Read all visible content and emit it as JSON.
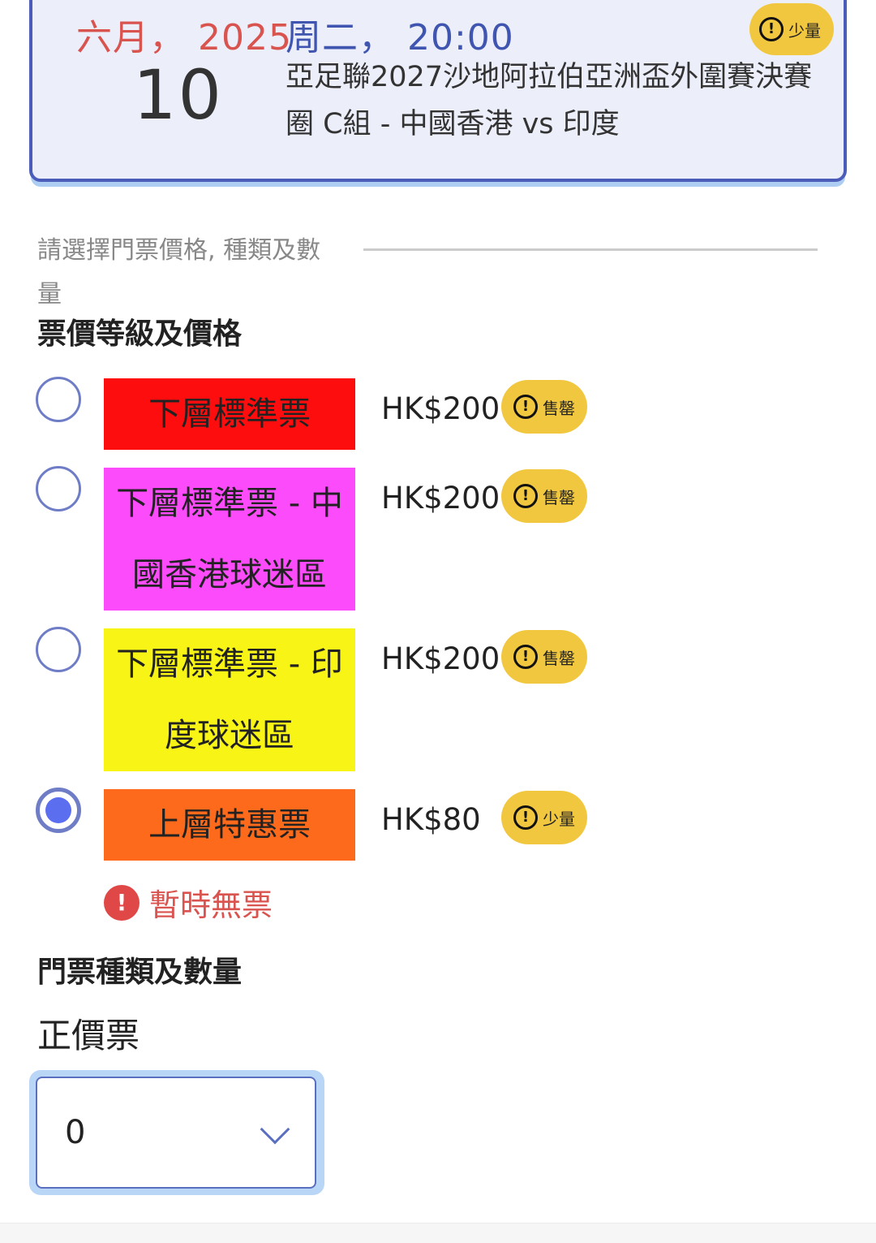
{
  "event": {
    "month_year": "六月， 2025",
    "weekday_time": "周二， 20:00",
    "day": "10",
    "title": "亞足聯2027沙地阿拉伯亞洲盃外圍賽決賽圈 C組 - 中國香港 vs 印度",
    "availability_badge": "少量"
  },
  "selection": {
    "prompt": "請選擇門票價格, 種類及數量",
    "price_heading": "票價等級及價格",
    "tiers": [
      {
        "label": "下層標準票",
        "price": "HK$200",
        "status": "售罄",
        "color": "#fd0d0d",
        "selected": false
      },
      {
        "label": "下層標準票 - 中國香港球迷區",
        "price": "HK$200",
        "status": "售罄",
        "color": "#fb4bfb",
        "selected": false
      },
      {
        "label": "下層標準票 - 印度球迷區",
        "price": "HK$200",
        "status": "售罄",
        "color": "#f8f415",
        "selected": false
      },
      {
        "label": "上層特惠票",
        "price": "HK$80",
        "status": "少量",
        "color": "#fd6a1c",
        "selected": true
      }
    ],
    "notice": "暫時無票"
  },
  "quantity": {
    "heading": "門票種類及數量",
    "ticket_type": "正價票",
    "selected_value": "0"
  }
}
